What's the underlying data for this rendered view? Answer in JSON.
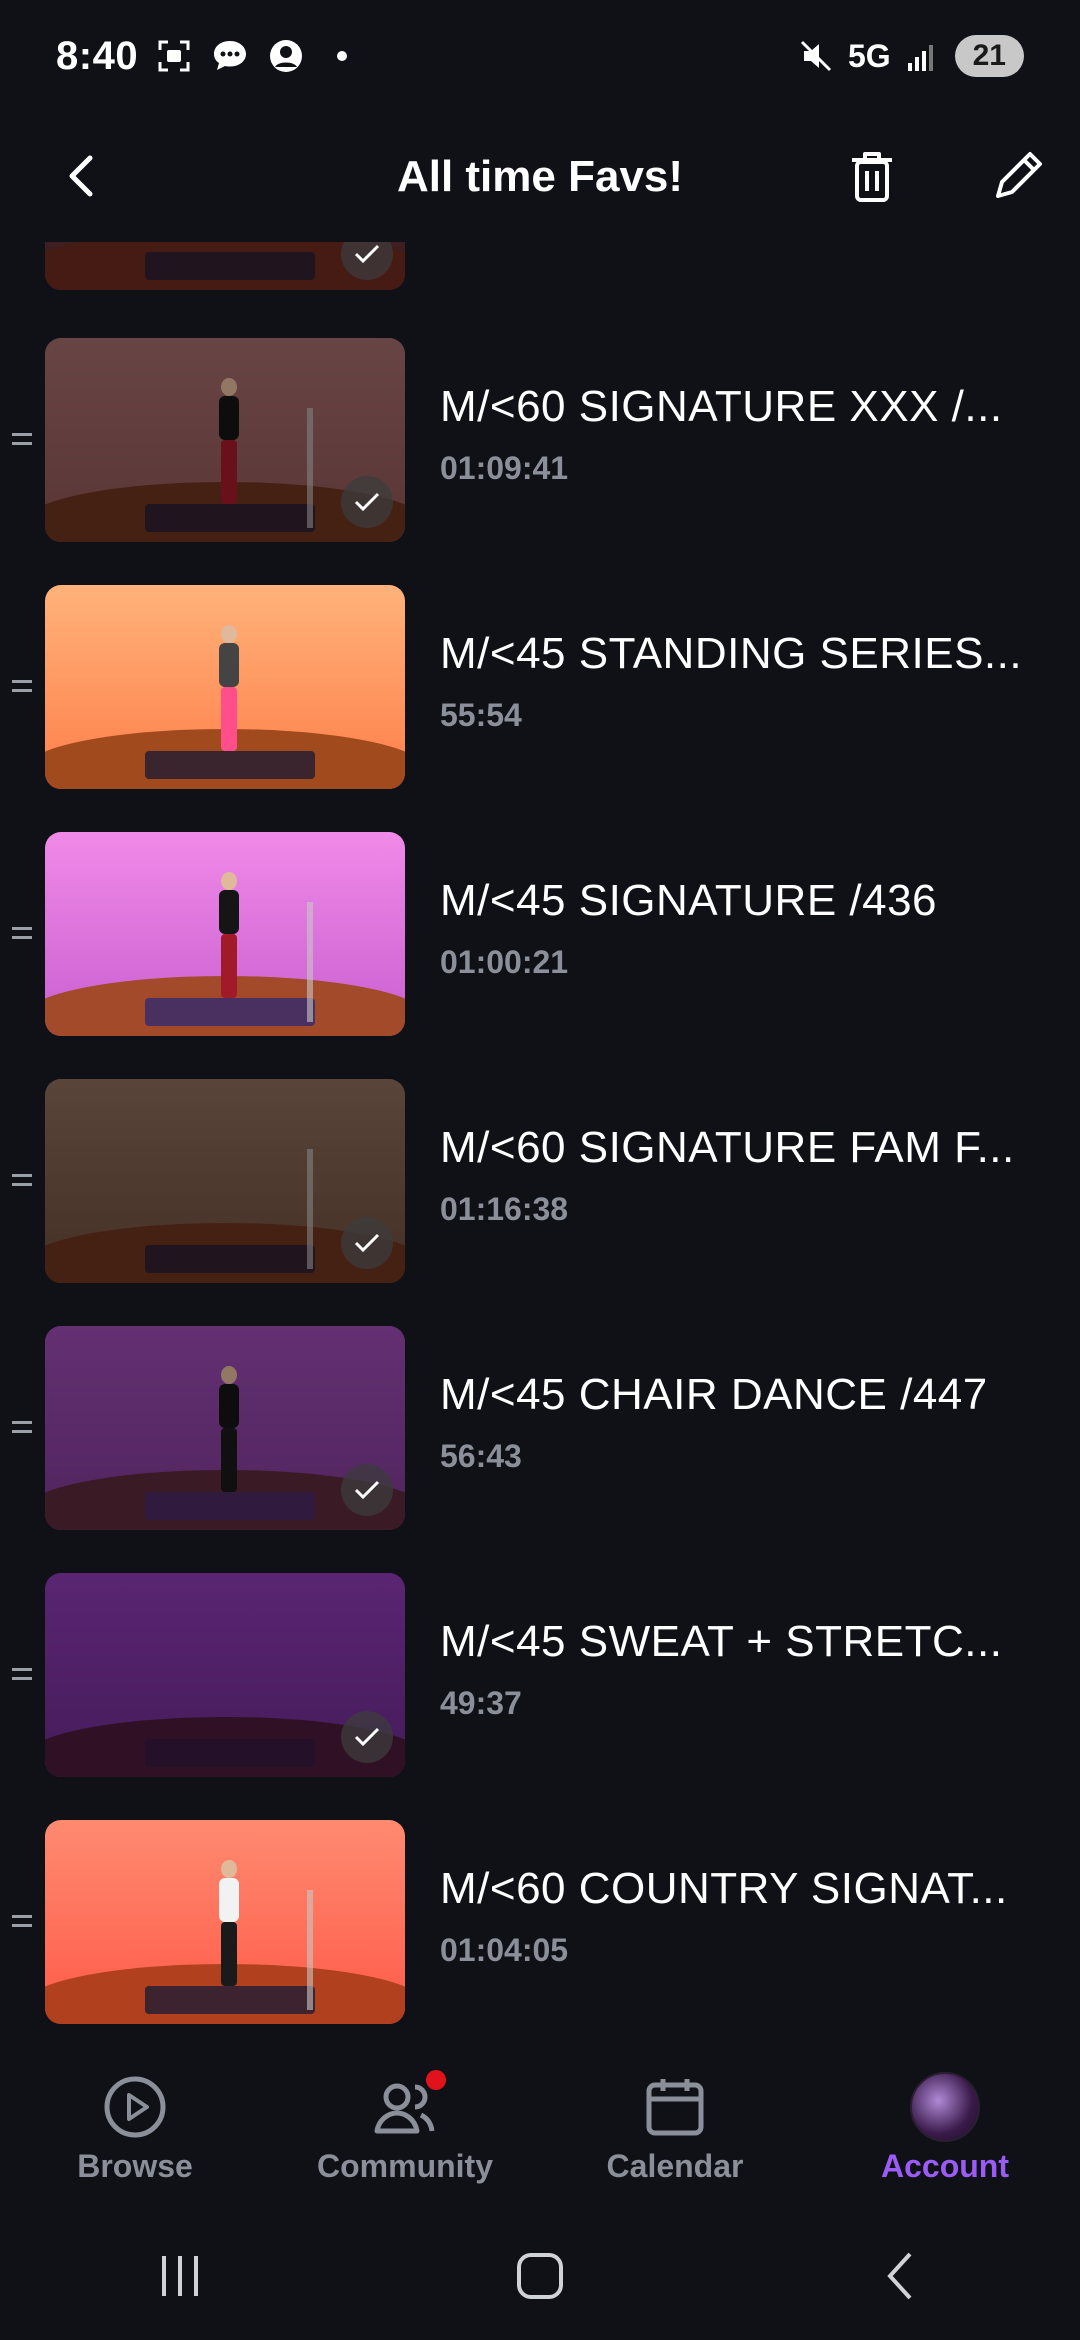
{
  "status": {
    "time": "8:40",
    "network": "5G",
    "battery": "21",
    "icons": [
      "screenshot-icon",
      "messages-icon",
      "account-circle-icon",
      "dot-icon",
      "mute-icon",
      "signal-icon"
    ]
  },
  "header": {
    "title": "All time Favs!",
    "back_icon": "chevron-left-icon",
    "trash_icon": "trash-icon",
    "edit_icon": "pencil-icon"
  },
  "list": {
    "items": [
      {
        "name": "M/<60 SIGNATURE XXX /...",
        "duration": "01:09:41",
        "completed": true
      },
      {
        "name": "M/<45 STANDING SERIES...",
        "duration": "55:54",
        "completed": false
      },
      {
        "name": "M/<45 SIGNATURE /436",
        "duration": "01:00:21",
        "completed": false
      },
      {
        "name": "M/<60 SIGNATURE FAM F...",
        "duration": "01:16:38",
        "completed": true
      },
      {
        "name": "M/<45 CHAIR DANCE /447",
        "duration": "56:43",
        "completed": true
      },
      {
        "name": "M/<45 SWEAT + STRETC...",
        "duration": "49:37",
        "completed": true
      },
      {
        "name": "M/<60 COUNTRY SIGNAT...",
        "duration": "01:04:05",
        "completed": false
      }
    ]
  },
  "tabs": [
    {
      "label": "Browse",
      "icon": "play-circle-icon",
      "active": false
    },
    {
      "label": "Community",
      "icon": "community-icon",
      "active": false,
      "badge": true
    },
    {
      "label": "Calendar",
      "icon": "calendar-icon",
      "active": false
    },
    {
      "label": "Account",
      "icon": "avatar",
      "active": true
    }
  ],
  "colors": {
    "background": "#0f1117",
    "accent": "#9b5cf6",
    "muted": "#8a8f99"
  }
}
